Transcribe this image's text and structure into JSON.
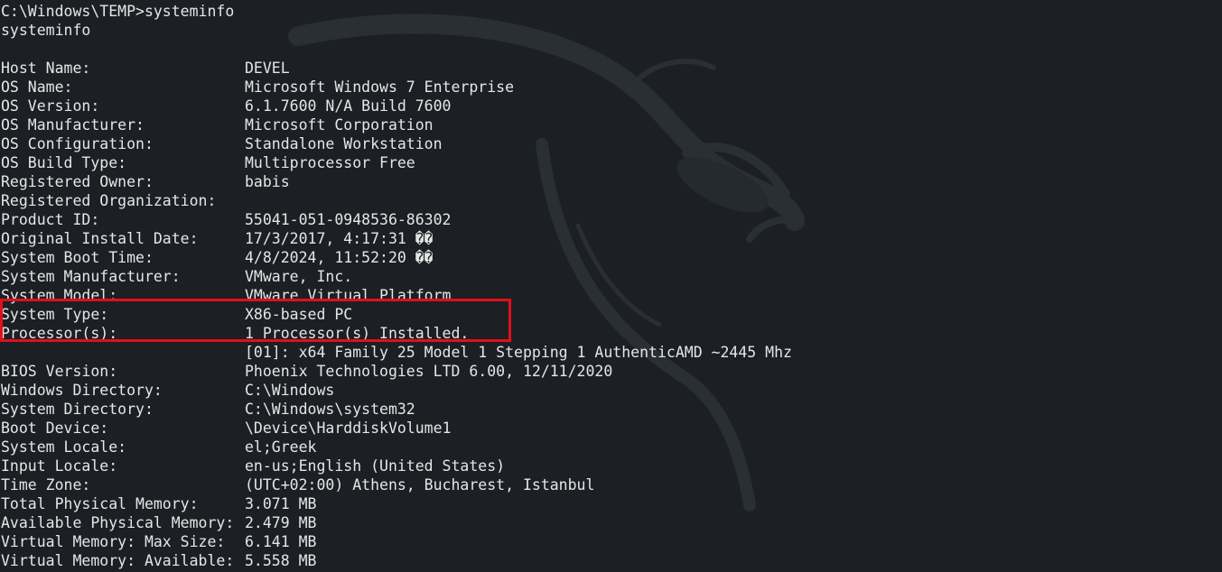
{
  "terminal": {
    "prompt_line": "C:\\Windows\\TEMP>systeminfo",
    "echo_line": "systeminfo",
    "rows": [
      {
        "label": "Host Name:",
        "value": "DEVEL"
      },
      {
        "label": "OS Name:",
        "value": "Microsoft Windows 7 Enterprise"
      },
      {
        "label": "OS Version:",
        "value": "6.1.7600 N/A Build 7600"
      },
      {
        "label": "OS Manufacturer:",
        "value": "Microsoft Corporation"
      },
      {
        "label": "OS Configuration:",
        "value": "Standalone Workstation"
      },
      {
        "label": "OS Build Type:",
        "value": "Multiprocessor Free"
      },
      {
        "label": "Registered Owner:",
        "value": "babis"
      },
      {
        "label": "Registered Organization:",
        "value": ""
      },
      {
        "label": "Product ID:",
        "value": "55041-051-0948536-86302"
      },
      {
        "label": "Original Install Date:",
        "value": "17/3/2017, 4:17:31 ��"
      },
      {
        "label": "System Boot Time:",
        "value": "4/8/2024, 11:52:20 ��"
      },
      {
        "label": "System Manufacturer:",
        "value": "VMware, Inc."
      },
      {
        "label": "System Model:",
        "value": "VMware Virtual Platform"
      },
      {
        "label": "System Type:",
        "value": "X86-based PC"
      },
      {
        "label": "Processor(s):",
        "value": "1 Processor(s) Installed."
      },
      {
        "label": "",
        "value": "[01]: x64 Family 25 Model 1 Stepping 1 AuthenticAMD ~2445 Mhz"
      },
      {
        "label": "BIOS Version:",
        "value": "Phoenix Technologies LTD 6.00, 12/11/2020"
      },
      {
        "label": "Windows Directory:",
        "value": "C:\\Windows"
      },
      {
        "label": "System Directory:",
        "value": "C:\\Windows\\system32"
      },
      {
        "label": "Boot Device:",
        "value": "\\Device\\HarddiskVolume1"
      },
      {
        "label": "System Locale:",
        "value": "el;Greek"
      },
      {
        "label": "Input Locale:",
        "value": "en-us;English (United States)"
      },
      {
        "label": "Time Zone:",
        "value": "(UTC+02:00) Athens, Bucharest, Istanbul"
      },
      {
        "label": "Total Physical Memory:",
        "value": "3.071 MB"
      },
      {
        "label": "Available Physical Memory:",
        "value": "2.479 MB"
      },
      {
        "label": "Virtual Memory: Max Size:",
        "value": "6.141 MB"
      },
      {
        "label": "Virtual Memory: Available:",
        "value": "5.558 MB"
      }
    ]
  },
  "colors": {
    "background": "#1c1f24",
    "text": "#e6e6e6",
    "highlight_border": "#e0101b"
  },
  "icons": {
    "background_logo": "kali-dragon-icon"
  }
}
